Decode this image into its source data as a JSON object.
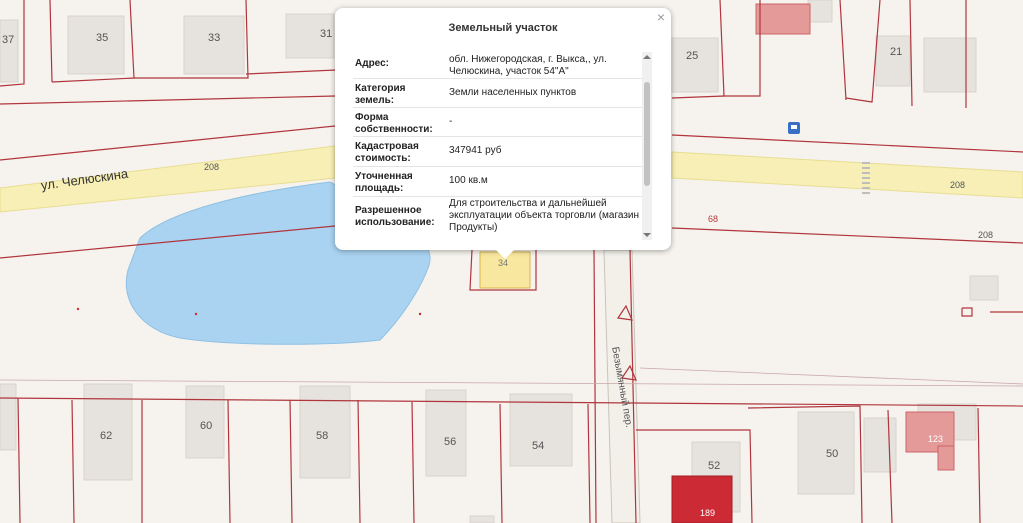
{
  "map": {
    "street_label": "ул. Челюскина",
    "lane_label": "Безымянный пер.",
    "road_number_left": "208",
    "road_number_right": "208",
    "road_number_far_right": "208",
    "bus_stop_icon": "bus-stop-icon",
    "house_numbers": {
      "n37": "37",
      "n35": "35",
      "n33": "33",
      "n31": "31",
      "n25": "25",
      "n21": "21",
      "n62": "62",
      "n60": "60",
      "n58": "58",
      "n56": "56",
      "n54": "54",
      "n52": "52",
      "n50": "50",
      "n34": "34"
    },
    "parcel_numbers": {
      "p68": "68",
      "p123": "123",
      "p189": "189"
    },
    "colors": {
      "parcel_border": "#b0353d",
      "road": "#f7efb5",
      "water": "#a9d3f1",
      "building": "#e6e2dd",
      "highlight": "#f8e79e"
    }
  },
  "popup": {
    "title": "Земельный участок",
    "close_label": "×",
    "rows": [
      {
        "key": "Адрес:",
        "value": "обл. Нижегородская, г. Выкса,, ул. Челюскина, участок 54\"А\""
      },
      {
        "key": "Категория земель:",
        "value": "Земли населенных пунктов"
      },
      {
        "key": "Форма собственности:",
        "value": "-"
      },
      {
        "key": "Кадастровая стоимость:",
        "value": "347941 руб"
      },
      {
        "key": "Уточненная площадь:",
        "value": "100 кв.м"
      },
      {
        "key": "Разрешенное использование:",
        "value": "Для строительства и дальнейшей эксплуатации объекта торговли (магазин Продукты)"
      }
    ]
  }
}
